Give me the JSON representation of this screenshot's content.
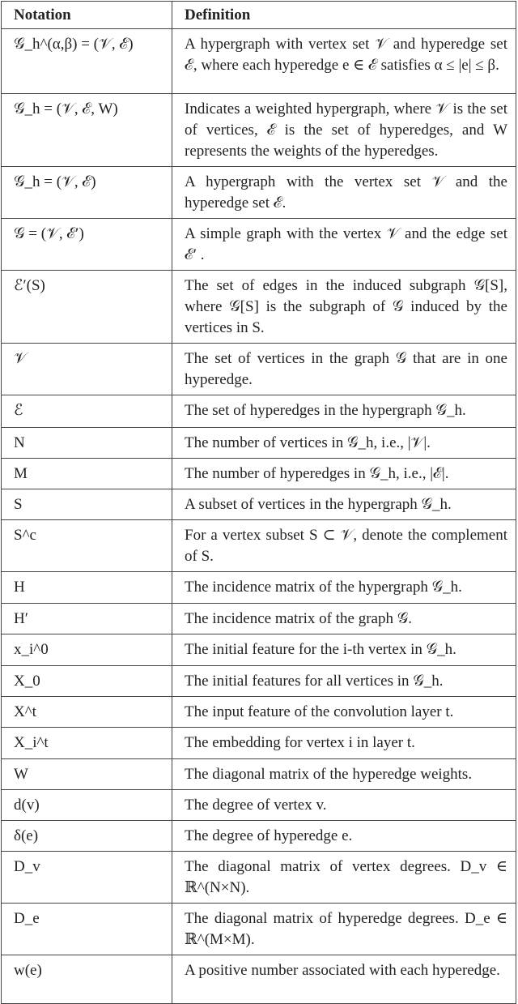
{
  "table": {
    "headers": [
      "Notation",
      "Definition"
    ],
    "rows": [
      {
        "notation": "𝒢_h^(α,β) = (𝒱, ℰ)",
        "definition": "A hypergraph with vertex set 𝒱 and hyperedge set ℰ, where each hyperedge e ∈ ℰ satisfies α ≤ |e| ≤ β."
      },
      {
        "notation": "𝒢_h = (𝒱, ℰ, W)",
        "definition": "Indicates a weighted hypergraph, where 𝒱 is the set of vertices, ℰ is the set of hyperedges, and W represents the weights of the hyperedges."
      },
      {
        "notation": "𝒢_h = (𝒱, ℰ)",
        "definition": "A hypergraph with the vertex set 𝒱 and the hyperedge set ℰ."
      },
      {
        "notation": "𝒢 = (𝒱, ℰ′)",
        "definition": "A simple graph with the vertex 𝒱 and the edge set ℰ′ ."
      },
      {
        "notation": "ℰ′(S)",
        "definition": "The set of edges in the induced subgraph 𝒢[S], where 𝒢[S] is the subgraph of 𝒢 induced by the vertices in S."
      },
      {
        "notation": "𝒱",
        "definition": "The set of vertices in the graph 𝒢 that are in one hyperedge."
      },
      {
        "notation": "ℰ",
        "definition": "The set of hyperedges in the hypergraph 𝒢_h."
      },
      {
        "notation": "N",
        "definition": "The number of vertices in 𝒢_h, i.e., |𝒱|."
      },
      {
        "notation": "M",
        "definition": "The number of hyperedges in 𝒢_h, i.e., |ℰ|."
      },
      {
        "notation": "S",
        "definition": "A subset of vertices in the hypergraph 𝒢_h."
      },
      {
        "notation": "S^c",
        "definition": "For a vertex subset S ⊂ 𝒱, denote the complement of S."
      },
      {
        "notation": "H",
        "definition": "The incidence matrix of the hypergraph 𝒢_h."
      },
      {
        "notation": "H′",
        "definition": "The incidence matrix of the graph 𝒢."
      },
      {
        "notation": "x_i^0",
        "definition": "The initial feature for the i-th vertex in 𝒢_h."
      },
      {
        "notation": "X_0",
        "definition": "The initial features for all vertices in 𝒢_h."
      },
      {
        "notation": "X^t",
        "definition": "The input feature of the convolution layer t."
      },
      {
        "notation": "X_i^t",
        "definition": "The embedding for vertex i in layer t."
      },
      {
        "notation": "W",
        "definition": "The diagonal matrix of the hyperedge weights."
      },
      {
        "notation": "d(v)",
        "definition": "The degree of vertex v."
      },
      {
        "notation": "δ(e)",
        "definition": "The degree of hyperedge e."
      },
      {
        "notation": "D_v",
        "definition": "The diagonal matrix of vertex degrees. D_v ∈ ℝ^(N×N)."
      },
      {
        "notation": "D_e",
        "definition": "The diagonal matrix of hyperedge degrees. D_e ∈ ℝ^(M×M)."
      },
      {
        "notation": "w(e)",
        "definition": "A positive number associated with each hyperedge."
      }
    ]
  }
}
